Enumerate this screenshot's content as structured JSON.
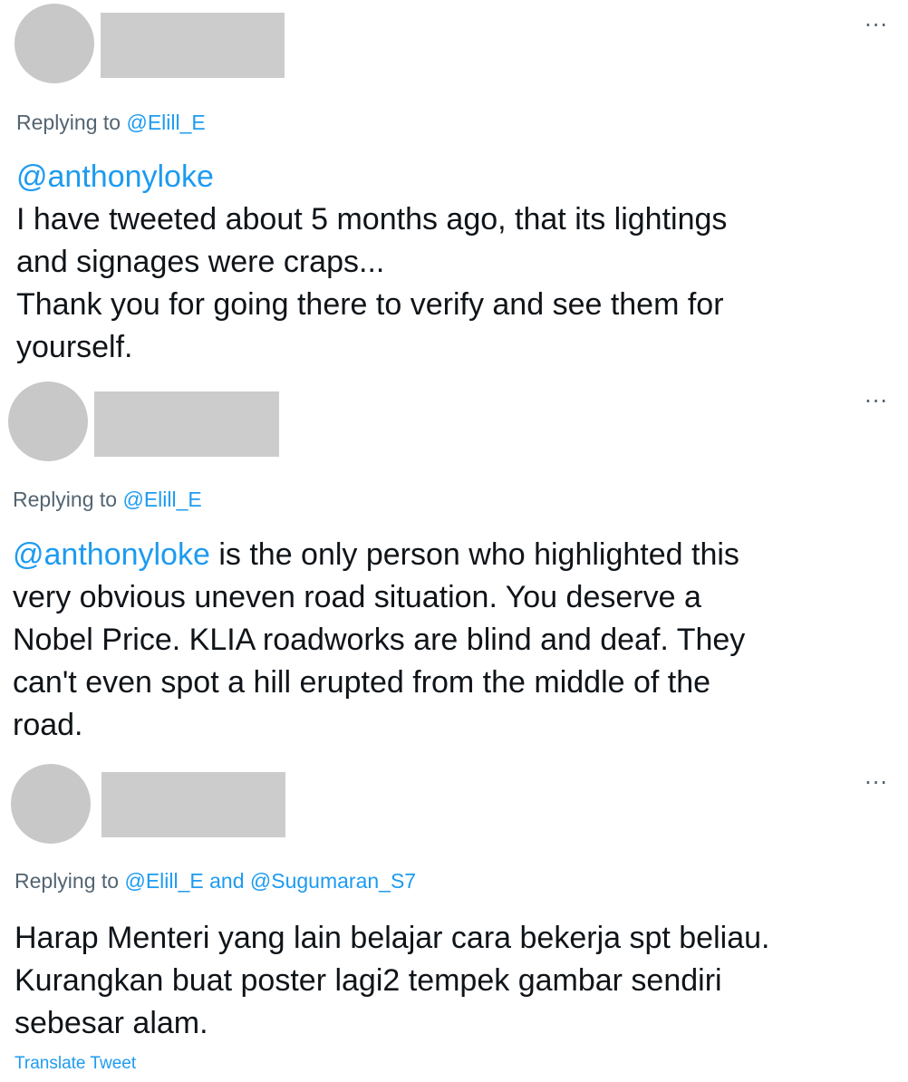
{
  "tweets": [
    {
      "more_label": "···",
      "replying_prefix": "Replying to",
      "reply_handles": [
        "@Elill_E"
      ],
      "mention": "@anthonyloke",
      "lines": [
        "I have tweeted about 5 months ago, that its lightings",
        "and signages were craps...",
        "Thank you for going there to verify and see them for",
        "yourself."
      ]
    },
    {
      "more_label": "···",
      "replying_prefix": "Replying to",
      "reply_handles": [
        "@Elill_E"
      ],
      "mention": "@anthonyloke",
      "first_line_rest": " is the only person who highlighted this",
      "lines": [
        "very obvious uneven road situation. You deserve a",
        "Nobel Price. KLIA roadworks are blind and deaf. They",
        "can't even spot a hill erupted from the middle of the",
        "road."
      ]
    },
    {
      "more_label": "···",
      "replying_prefix": "Replying to",
      "reply_handles": [
        "@Elill_E",
        "@Sugumaran_S7"
      ],
      "reply_joiner": "and",
      "lines": [
        "Harap Menteri yang lain belajar cara bekerja spt beliau.",
        "Kurangkan buat poster lagi2 tempek gambar sendiri",
        "sebesar alam."
      ],
      "translate_label": "Translate Tweet"
    }
  ]
}
